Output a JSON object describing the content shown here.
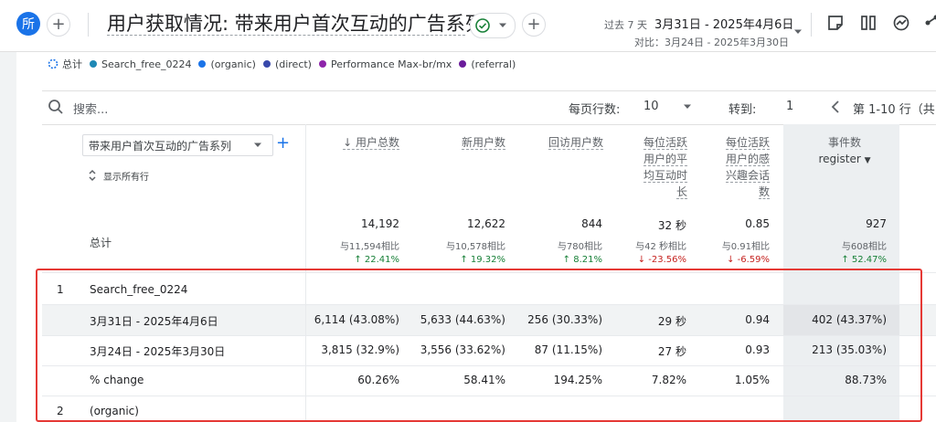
{
  "header": {
    "avatar_letter": "所",
    "title": "用户获取情况: 带来用户首次互动的广告系列",
    "date_preset": "过去 7 天",
    "date_range": "3月31日 - 2025年4月6日",
    "compare_label": "对比：3月24日 - 2025年3月30日"
  },
  "legend": [
    {
      "label": "总计",
      "color": "#9aa0a6"
    },
    {
      "label": "Search_free_0224",
      "color": "#1e88b5"
    },
    {
      "label": "(organic)",
      "color": "#1a73e8"
    },
    {
      "label": "(direct)",
      "color": "#3949ab"
    },
    {
      "label": "Performance Max-br/mx",
      "color": "#8e24aa"
    },
    {
      "label": "(referral)",
      "color": "#6a1b9a"
    }
  ],
  "toolbar": {
    "search_placeholder": "搜索...",
    "rows_per_page_label": "每页行数:",
    "rows_per_page_value": "10",
    "goto_label": "转到:",
    "goto_value": "1",
    "pagination": "第 1-10 行（共 1"
  },
  "dimension": {
    "selector": "带来用户首次互动的广告系列",
    "show_all_rows": "显示所有行"
  },
  "columns": [
    {
      "label": "↓ 用户总数"
    },
    {
      "label": "新用户数"
    },
    {
      "label": "回访用户数"
    },
    {
      "label": "每位活跃用户的平均互动时长"
    },
    {
      "label": "每位活跃用户的感兴趣会话数"
    },
    {
      "label": "事件数",
      "sub": "register"
    }
  ],
  "totals": {
    "label": "总计",
    "values": [
      "14,192",
      "12,622",
      "844",
      "32 秒",
      "0.85",
      "927"
    ],
    "compare": [
      "与11,594相比",
      "与10,578相比",
      "与780相比",
      "与42 秒相比",
      "与0.91相比",
      "与608相比"
    ],
    "change": [
      "↑ 22.41%",
      "↑ 19.32%",
      "↑ 8.21%",
      "↓ -23.56%",
      "↓ -6.59%",
      "↑ 52.47%"
    ]
  },
  "rows": [
    {
      "index": "1",
      "name": "Search_free_0224"
    },
    {
      "index": "",
      "name": "3月31日 - 2025年4月6日",
      "values": [
        "6,114 (43.08%)",
        "5,633 (44.63%)",
        "256 (30.33%)",
        "29 秒",
        "0.94",
        "402 (43.37%)"
      ]
    },
    {
      "index": "",
      "name": "3月24日 - 2025年3月30日",
      "values": [
        "3,815 (32.9%)",
        "3,556 (33.62%)",
        "87 (11.15%)",
        "27 秒",
        "0.93",
        "213 (35.03%)"
      ]
    },
    {
      "index": "",
      "name": "% change",
      "values": [
        "60.26%",
        "58.41%",
        "194.25%",
        "7.82%",
        "1.05%",
        "88.73%"
      ]
    },
    {
      "index": "2",
      "name": "(organic)"
    }
  ]
}
